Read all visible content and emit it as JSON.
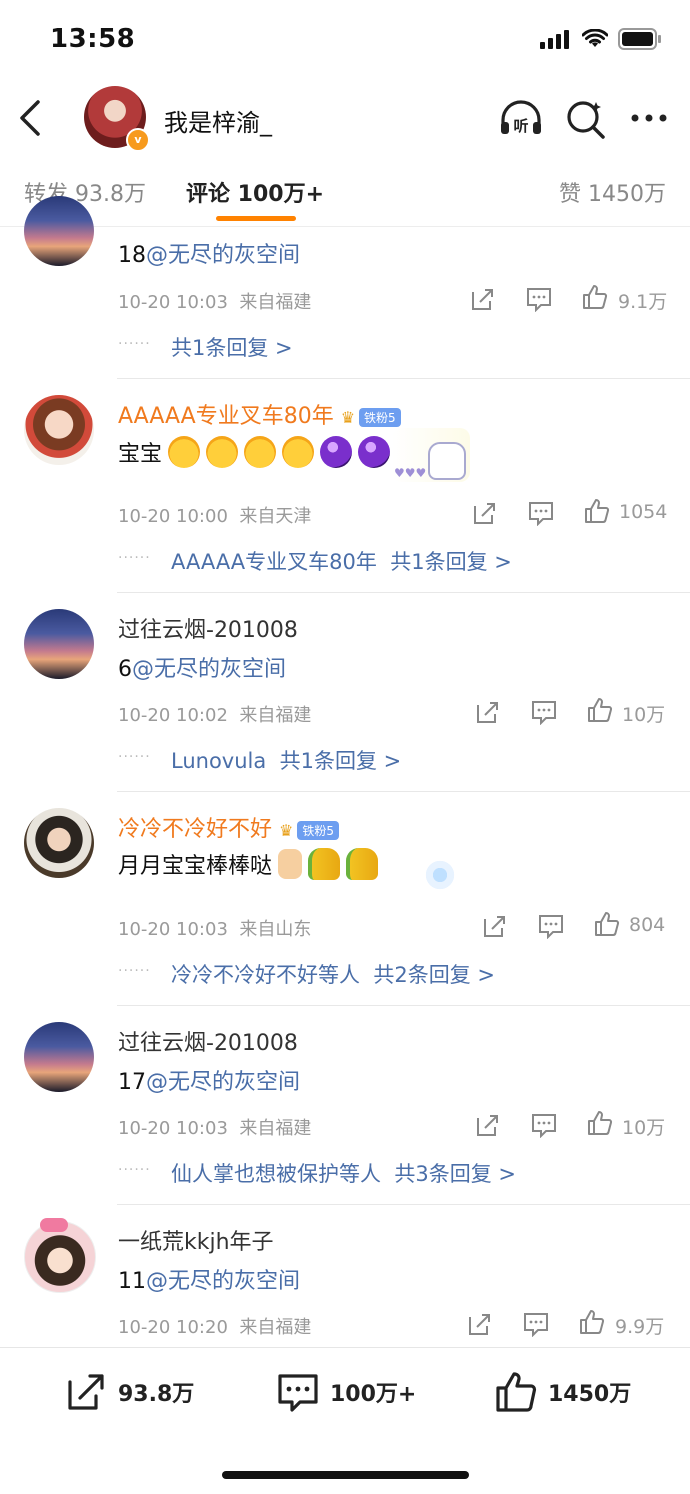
{
  "status": {
    "time": "13:58"
  },
  "header": {
    "username": "我是梓渝_",
    "icons": [
      "back-arrow-icon",
      "headphones-listen-icon",
      "search-icon",
      "more-icon"
    ],
    "listen_label": "听"
  },
  "tabs": {
    "repost": "转发 93.8万",
    "comment": "评论 100万+",
    "like": "赞 1450万"
  },
  "comments": [
    {
      "name": "",
      "text_num": "18",
      "mention": "@无尽的灰空间",
      "time": "10-20 10:03",
      "location": "来自福建",
      "likes": "9.1万",
      "reply": "共1条回复 >"
    },
    {
      "name": "AAAAA专业叉车80年",
      "fan_badge": "铁粉5",
      "text": "宝宝",
      "time": "10-20 10:00",
      "location": "来自天津",
      "likes": "1054",
      "reply_user": "AAAAA专业叉车80年",
      "reply": "共1条回复 >"
    },
    {
      "name": "过往云烟-201008",
      "text_num": "6",
      "mention": "@无尽的灰空间",
      "time": "10-20 10:02",
      "location": "来自福建",
      "likes": "10万",
      "reply_user": "Lunovula",
      "reply": "共1条回复 >"
    },
    {
      "name": "冷冷不冷好不好",
      "fan_badge": "铁粉5",
      "text": "月月宝宝棒棒哒",
      "time": "10-20 10:03",
      "location": "来自山东",
      "likes": "804",
      "reply_user": "冷冷不冷好不好等人",
      "reply": "共2条回复 >"
    },
    {
      "name": "过往云烟-201008",
      "text_num": "17",
      "mention": "@无尽的灰空间",
      "time": "10-20 10:03",
      "location": "来自福建",
      "likes": "10万",
      "reply_user": "仙人掌也想被保护等人",
      "reply": "共3条回复 >"
    },
    {
      "name": "一纸荒kkjh年子",
      "text_num": "11",
      "mention": "@无尽的灰空间",
      "time": "10-20 10:20",
      "location": "来自福建",
      "likes": "9.9万"
    }
  ],
  "bottom_bar": {
    "repost": "93.8万",
    "comment": "100万+",
    "like": "1450万"
  },
  "colors": {
    "accent": "#ff8200",
    "link": "#4a6ea8",
    "vip_name": "#f07a1e"
  }
}
